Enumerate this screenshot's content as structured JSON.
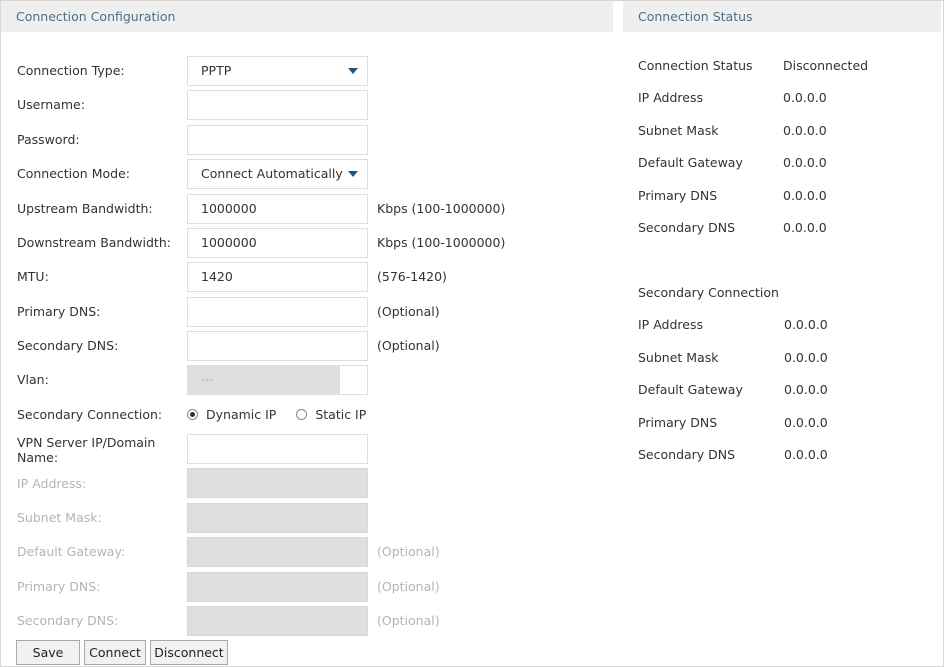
{
  "config_panel": {
    "title": "Connection Configuration",
    "connection_type": {
      "label": "Connection Type:",
      "value": "PPTP"
    },
    "username": {
      "label": "Username:",
      "value": ""
    },
    "password": {
      "label": "Password:",
      "value": ""
    },
    "connection_mode": {
      "label": "Connection Mode:",
      "value": "Connect Automatically"
    },
    "upstream_bandwidth": {
      "label": "Upstream Bandwidth:",
      "value": "1000000",
      "hint": "Kbps (100-1000000)"
    },
    "downstream_bandwidth": {
      "label": "Downstream Bandwidth:",
      "value": "1000000",
      "hint": "Kbps (100-1000000)"
    },
    "mtu": {
      "label": "MTU:",
      "value": "1420",
      "hint": "(576-1420)"
    },
    "primary_dns": {
      "label": "Primary DNS:",
      "value": "",
      "hint": "(Optional)"
    },
    "secondary_dns": {
      "label": "Secondary DNS:",
      "value": "",
      "hint": "(Optional)"
    },
    "vlan": {
      "label": "Vlan:",
      "value": "---"
    },
    "secondary_connection": {
      "label": "Secondary Connection:",
      "options": [
        "Dynamic IP",
        "Static IP"
      ],
      "selected": "Dynamic IP"
    },
    "vpn_server": {
      "label": "VPN Server IP/Domain Name:",
      "value": ""
    },
    "sec_ip_address": {
      "label": "IP Address:",
      "value": ""
    },
    "sec_subnet_mask": {
      "label": "Subnet Mask:",
      "value": ""
    },
    "sec_default_gateway": {
      "label": "Default Gateway:",
      "value": "",
      "hint": "(Optional)"
    },
    "sec_primary_dns": {
      "label": "Primary DNS:",
      "value": "",
      "hint": "(Optional)"
    },
    "sec_secondary_dns": {
      "label": "Secondary DNS:",
      "value": "",
      "hint": "(Optional)"
    },
    "buttons": {
      "save": "Save",
      "connect": "Connect",
      "disconnect": "Disconnect"
    }
  },
  "status_panel": {
    "title": "Connection Status",
    "primary": [
      {
        "label": "Connection Status",
        "value": "Disconnected"
      },
      {
        "label": "IP Address",
        "value": "0.0.0.0"
      },
      {
        "label": "Subnet Mask",
        "value": "0.0.0.0"
      },
      {
        "label": "Default Gateway",
        "value": "0.0.0.0"
      },
      {
        "label": "Primary DNS",
        "value": "0.0.0.0"
      },
      {
        "label": "Secondary DNS",
        "value": "0.0.0.0"
      }
    ],
    "secondary_title": "Secondary Connection",
    "secondary": [
      {
        "label": "IP Address",
        "value": "0.0.0.0"
      },
      {
        "label": "Subnet Mask",
        "value": "0.0.0.0"
      },
      {
        "label": "Default Gateway",
        "value": "0.0.0.0"
      },
      {
        "label": "Primary DNS",
        "value": "0.0.0.0"
      },
      {
        "label": "Secondary DNS",
        "value": "0.0.0.0"
      }
    ]
  },
  "colors": {
    "header_bg": "#efefef",
    "header_text": "#4a6f8a",
    "caret": "#1b5584",
    "disabled_field": "#e0dfdd"
  }
}
